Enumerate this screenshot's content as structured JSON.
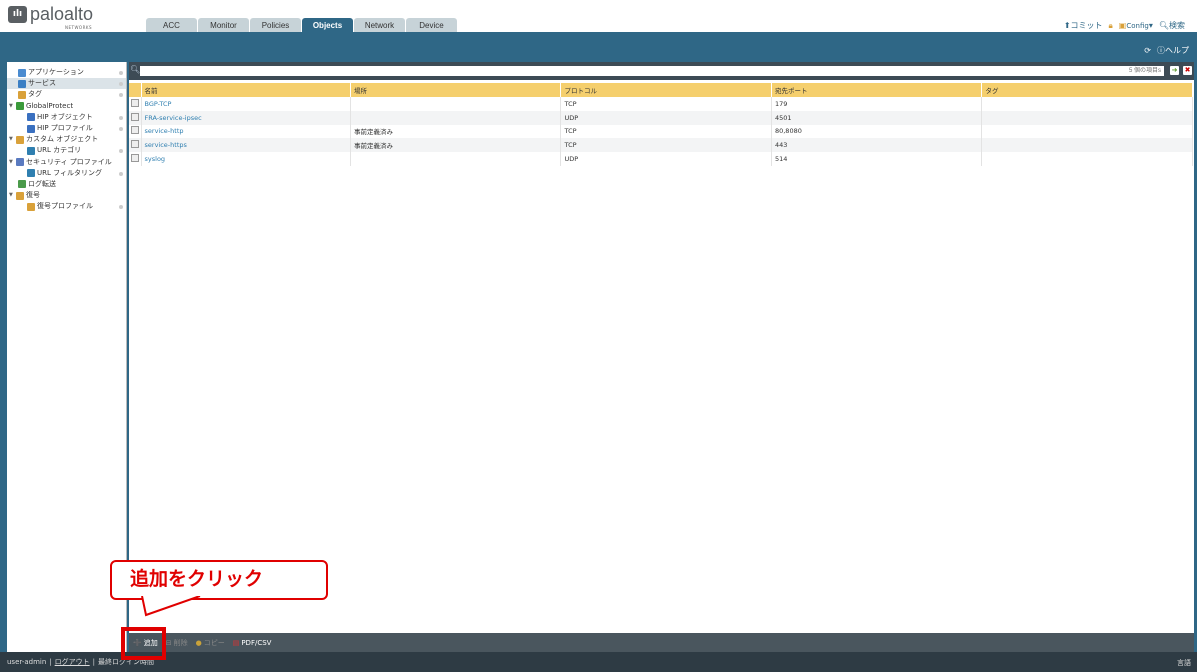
{
  "brand": {
    "name": "paloalto",
    "sub": "NETWORKS"
  },
  "tabs": [
    "ACC",
    "Monitor",
    "Policies",
    "Objects",
    "Network",
    "Device"
  ],
  "active_tab": "Objects",
  "topright": {
    "commit": "コミット",
    "config": "Config",
    "search": "検索"
  },
  "help": "ヘルプ",
  "sidebar": [
    {
      "label": "アプリケーション",
      "indent": 1
    },
    {
      "label": "サービス",
      "indent": 1,
      "selected": true
    },
    {
      "label": "タグ",
      "indent": 1
    },
    {
      "label": "GlobalProtect",
      "indent": 0,
      "tri": true
    },
    {
      "label": "HIP オブジェクト",
      "indent": 2
    },
    {
      "label": "HIP プロファイル",
      "indent": 2
    },
    {
      "label": "カスタム オブジェクト",
      "indent": 0,
      "tri": true
    },
    {
      "label": "URL カテゴリ",
      "indent": 2
    },
    {
      "label": "セキュリティ プロファイル",
      "indent": 0,
      "tri": true
    },
    {
      "label": "URL フィルタリング",
      "indent": 2
    },
    {
      "label": "ログ転送",
      "indent": 1
    },
    {
      "label": "復号",
      "indent": 0,
      "tri": true
    },
    {
      "label": "復号プロファイル",
      "indent": 2
    }
  ],
  "search": {
    "count": "5 個の項目s"
  },
  "table": {
    "headers": [
      "名前",
      "場所",
      "プロトコル",
      "宛先ポート",
      "タグ"
    ],
    "rows": [
      [
        "BGP-TCP",
        "",
        "TCP",
        "179",
        ""
      ],
      [
        "FRA-service-ipsec",
        "",
        "UDP",
        "4501",
        ""
      ],
      [
        "service-http",
        "事前定義済み",
        "TCP",
        "80,8080",
        ""
      ],
      [
        "service-https",
        "事前定義済み",
        "TCP",
        "443",
        ""
      ],
      [
        "syslog",
        "",
        "UDP",
        "514",
        ""
      ]
    ]
  },
  "toolbar": {
    "add": "追加",
    "delete": "削除",
    "copy": "コピー",
    "pdf": "PDF/CSV"
  },
  "footer": {
    "user": "user-admin",
    "logout": "ログアウト",
    "last_login": "最終ログイン時間",
    "lang": "言語"
  },
  "callout": "追加をクリック"
}
